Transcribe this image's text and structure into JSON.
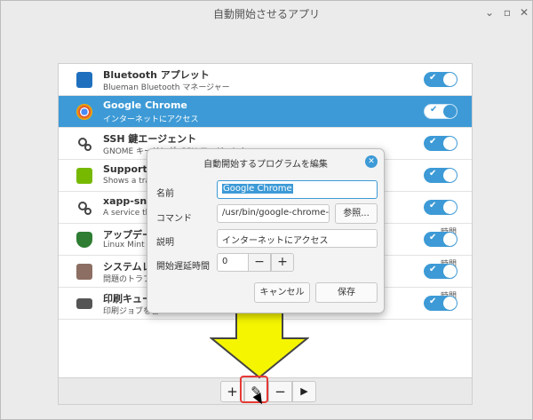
{
  "window": {
    "title": "自動開始させるアプリ"
  },
  "apps": [
    {
      "name": "Bluetooth アプレット",
      "description": "Blueman Bluetooth マネージャー",
      "icon": "bluetooth-icon",
      "enabled": true,
      "delay": ""
    },
    {
      "name": "Google Chrome",
      "description": "インターネットにアクセス",
      "icon": "chrome-icon",
      "enabled": true,
      "delay": "",
      "selected": true
    },
    {
      "name": "SSH 鍵エージェント",
      "description": "GNOME キーリング: SSH エージェント",
      "icon": "gear-icon",
      "enabled": true,
      "delay": ""
    },
    {
      "name": "Support for",
      "description": "Shows a tray i",
      "icon": "nvidia-icon",
      "enabled": true,
      "delay": ""
    },
    {
      "name": "xapp-sn-wa",
      "description": "A service that",
      "icon": "gear-icon",
      "enabled": true,
      "delay": ""
    },
    {
      "name": "アップデート",
      "description": "Linux Mint Up",
      "icon": "shield-icon",
      "enabled": true,
      "delay": "時間\n0 秒"
    },
    {
      "name": "システムレポ",
      "description": "問題のトラブル",
      "icon": "report-icon",
      "enabled": true,
      "delay": "時間\n0 秒"
    },
    {
      "name": "印刷キューの",
      "description": "印刷ジョブを管",
      "icon": "printer-icon",
      "enabled": true,
      "delay": "時間\n0 秒"
    }
  ],
  "toolbar": {
    "add": "+",
    "edit": "✎",
    "remove": "−",
    "run": "▶"
  },
  "dialog": {
    "title": "自動開始するプログラムを編集",
    "name_label": "名前",
    "name_value": "Google Chrome",
    "command_label": "コマンド",
    "command_value": "/usr/bin/google-chrome-",
    "browse_label": "参照...",
    "description_label": "説明",
    "description_value": "インターネットにアクセス",
    "delay_label": "開始遅延時間",
    "delay_value": "0",
    "decrement": "−",
    "increment": "+",
    "cancel_label": "キャンセル",
    "save_label": "保存"
  },
  "colors": {
    "accent": "#3d9ad6",
    "annotation_arrow": "#f5f500",
    "highlight": "#e53935"
  }
}
